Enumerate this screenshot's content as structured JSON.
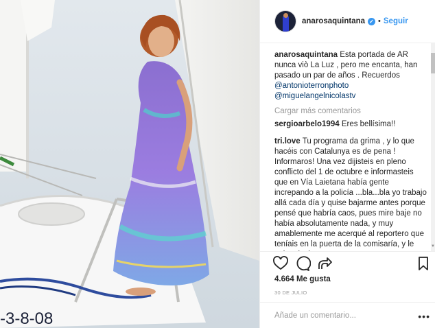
{
  "header": {
    "username": "anarosaquintana",
    "verified_icon": "verified-badge-icon",
    "separator": "•",
    "follow_label": "Seguir"
  },
  "photo": {
    "alt": "",
    "hull_text": "-3-8-08"
  },
  "caption": {
    "username": "anarosaquintana",
    "text": "Esta portada de AR nunca viò La Luz , pero me encanta, han pasado un par de años . Recuerdos",
    "mention_1": "@antonioterronphoto",
    "mention_2": "@miguelangelnicolastv"
  },
  "load_more_label": "Cargar más comentarios",
  "comments": [
    {
      "username": "sergioarbelo1994",
      "text": "Eres bellísima!!"
    },
    {
      "username": "tri.love",
      "text": "Tu programa da grima , y lo que hacéis con Catalunya es de pena ! Informaros! Una vez dijisteis en pleno conflicto del 1 de octubre e informasteis que en Vía Laietana había gente increpando a la policía ...bla...bla yo trabajo allá cada día y quise bajarme antes porque pensé que habría caos, pues mire baje no había absolutamente nada, y muy amablemente me acerqué al reportero que teníais en la puerta de la comisaría, y le quise decir que , que pena"
    }
  ],
  "actions": {
    "like_icon": "heart-icon",
    "comment_icon": "comment-bubble-icon",
    "share_icon": "share-arrow-icon",
    "save_icon": "bookmark-icon"
  },
  "likes_text": "4.664 Me gusta",
  "date_text": "30 DE JULIO",
  "add_comment": {
    "placeholder": "Añade un comentario...",
    "more_label": "•••"
  },
  "colors": {
    "link_blue": "#3897f0",
    "mention": "#003569",
    "muted": "#999999",
    "border": "#efefef"
  }
}
